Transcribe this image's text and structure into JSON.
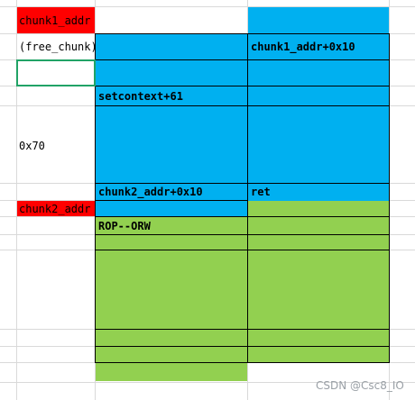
{
  "left_column": {
    "chunk1_label": "chunk1_addr",
    "free_chunk_label": "(free_chunk)",
    "size_label": "0x70",
    "chunk2_label": "chunk2_addr"
  },
  "memory_cells": {
    "chunk1_plus": "chunk1_addr+0x10",
    "setcontext": "setcontext+61",
    "chunk2_plus": "chunk2_addr+0x10",
    "ret": "ret",
    "rop": "ROP--ORW"
  },
  "watermark": "CSDN @Csc8_IO",
  "colors": {
    "red": "#ff0000",
    "blue": "#00b0f0",
    "green": "#92d050",
    "selection": "#21a366"
  }
}
